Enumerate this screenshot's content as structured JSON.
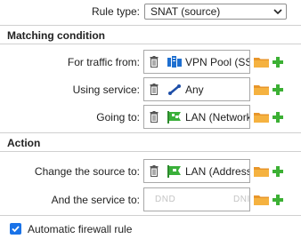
{
  "rule_type": {
    "label": "Rule type:",
    "value": "SNAT (source)"
  },
  "matching": {
    "title": "Matching condition",
    "traffic_from": {
      "label": "For traffic from:",
      "value": "VPN Pool (SS",
      "icon": "vpn-pool-icon"
    },
    "service": {
      "label": "Using service:",
      "value": "Any",
      "icon": "service-any-icon"
    },
    "going_to": {
      "label": "Going to:",
      "value": "LAN (Network",
      "icon": "lan-network-icon"
    }
  },
  "action": {
    "title": "Action",
    "change_source": {
      "label": "Change the source to:",
      "value": "LAN (Address",
      "icon": "lan-address-icon"
    },
    "service_to": {
      "label": "And the service to:",
      "placeholder_left": "DND",
      "placeholder_right": "DNI"
    }
  },
  "auto_firewall": {
    "label": "Automatic firewall rule",
    "checked": true
  },
  "colors": {
    "folder": "#f0a030",
    "plus": "#3cb034",
    "checkbox": "#1a73e8"
  }
}
